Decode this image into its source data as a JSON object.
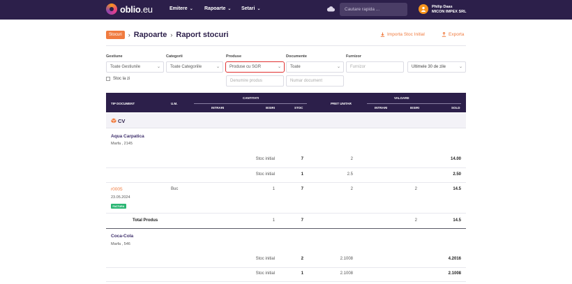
{
  "nav": {
    "logo_main": "oblio",
    "logo_suffix": ".eu",
    "menu": [
      "Emitere",
      "Rapoarte",
      "Setari"
    ],
    "search_placeholder": "Cautare rapida ...",
    "user_name": "Philip Daas",
    "company": "MICON IMPEX SRL"
  },
  "breadcrumb": {
    "badge": "Stocuri",
    "items": [
      "Rapoarte",
      "Raport stocuri"
    ]
  },
  "actions": {
    "import": "Importa Stoc Initial",
    "export": "Exporta"
  },
  "filters": {
    "gestiune": {
      "label": "Gestiune",
      "value": "Toate Gestiunile"
    },
    "categorii": {
      "label": "Categorii",
      "value": "Toate Categoriile"
    },
    "produse": {
      "label": "Produse",
      "value": "Produse cu SGR"
    },
    "documente": {
      "label": "Documente",
      "value": "Toate"
    },
    "furnizor": {
      "label": "Furnizor",
      "placeholder": "Furnizor"
    },
    "period": {
      "value": "Ultimele 30 de zile"
    },
    "denumire_placeholder": "Denumire produs",
    "numar_placeholder": "Numar document",
    "stoc_la_zi": "Stoc la zi"
  },
  "table": {
    "headers": {
      "tip": "TIP DOCUMENT",
      "um": "U.M.",
      "cantitati": "CANTITATI",
      "intrari": "INTRARI",
      "iesiri": "IESIRI",
      "stoc": "STOC",
      "pret": "PRET UNITAR",
      "valoare": "VALOARE",
      "v_intrari": "INTRARI",
      "v_iesiri": "IESIRI",
      "sold": "SOLD"
    },
    "group": "CV",
    "products": [
      {
        "name": "Aqua Carpatica",
        "meta": "Marfa , 2145",
        "rows": [
          {
            "label": "Stoc initial",
            "stoc": "7",
            "pret": "2",
            "sold": "14.00"
          },
          {
            "label": "Stoc initial",
            "stoc": "1",
            "pret": "2.5",
            "sold": "2.50"
          }
        ],
        "doc": {
          "code": "r0005",
          "date": "23.05.2024",
          "badge": "FACTURA",
          "um": "Buc",
          "intrari": "1",
          "stoc": "7",
          "pret": "2",
          "v_intrari": "2",
          "sold": "14.5"
        },
        "total": {
          "label": "Total Produs",
          "intrari": "1",
          "stoc": "7",
          "v_intrari": "2",
          "sold": "14.5"
        }
      },
      {
        "name": "Coca-Cola",
        "meta": "Marfa , 546",
        "rows": [
          {
            "label": "Stoc initial",
            "stoc": "2",
            "pret": "2.1008",
            "sold": "4.2016"
          },
          {
            "label": "Stoc initial",
            "stoc": "1",
            "pret": "2.1008",
            "sold": "2.1008"
          }
        ]
      }
    ]
  }
}
